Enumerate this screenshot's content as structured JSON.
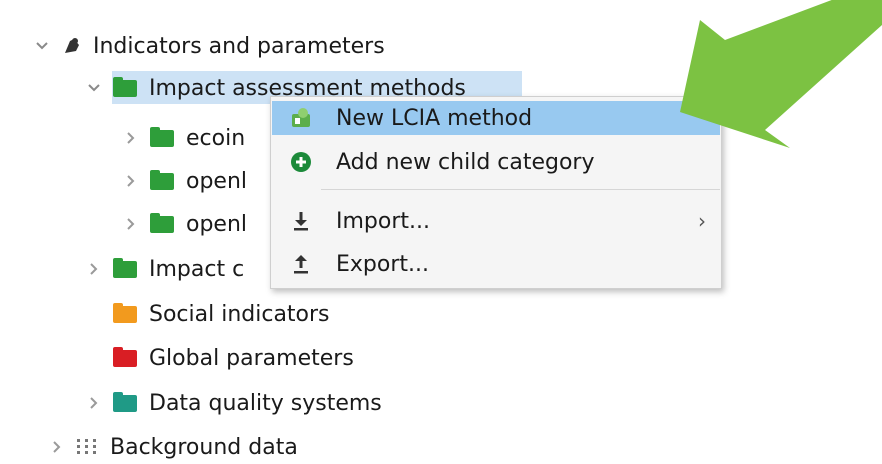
{
  "tree": {
    "partial_top": "",
    "indicators": "Indicators and parameters",
    "impact_methods": "Impact assessment methods",
    "child1": "ecoin",
    "child2": "openl",
    "child3": "openl",
    "impact_categories": "Impact c",
    "social": "Social indicators",
    "global_params": "Global parameters",
    "dq_systems": "Data quality systems",
    "background": "Background data"
  },
  "context_menu": {
    "new_lcia": "New LCIA method",
    "add_child": "Add new child category",
    "import": "Import...",
    "export": "Export..."
  },
  "colors": {
    "folder_green": "#2e9e3a",
    "folder_orange": "#f29a1e",
    "folder_red": "#d91e24",
    "folder_teal": "#1f9a86",
    "selection": "#cde2f5",
    "menu_highlight": "#98c9f0",
    "arrow_green": "#7cc242"
  },
  "icons": {
    "indicators": "brush-icon",
    "background": "grid-dots-icon",
    "new_lcia": "lcia-method-icon",
    "add_child": "add-circle-icon",
    "import": "import-icon",
    "export": "export-icon"
  }
}
